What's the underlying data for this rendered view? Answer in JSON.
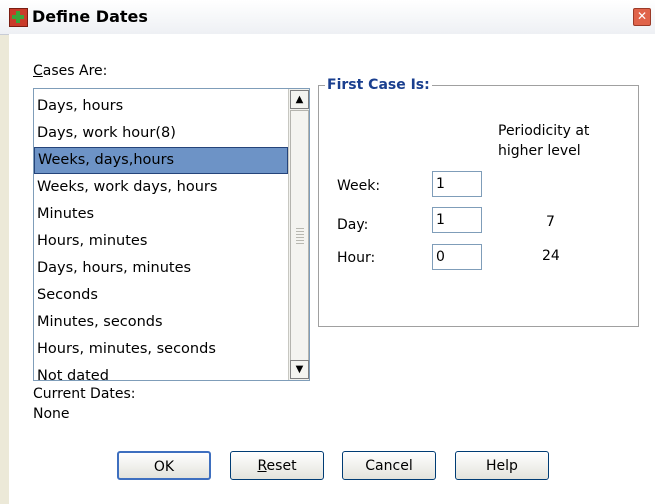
{
  "dialog": {
    "title": "Define Dates",
    "app_icon": "spss-dialog-icon",
    "close_icon": "close-icon"
  },
  "cases_are": {
    "label_access_key": "C",
    "label_rest": "ases Are:",
    "items": [
      "Days, hours",
      "Days, work hour(8)",
      "Weeks, days,hours",
      "Weeks, work days, hours",
      "Minutes",
      "Hours, minutes",
      "Days, hours, minutes",
      "Seconds",
      "Minutes, seconds",
      "Hours, minutes, seconds",
      "Not dated"
    ],
    "selected_index": 2
  },
  "first_case": {
    "legend": "First Case Is:",
    "periodicity_header": "Periodicity at higher level",
    "rows": [
      {
        "label": "Week:",
        "value": "1",
        "periodicity": ""
      },
      {
        "label": "Day:",
        "value": "1",
        "periodicity": "7"
      },
      {
        "label": "Hour:",
        "value": "0",
        "periodicity": "24"
      }
    ]
  },
  "current_dates": {
    "label": "Current Dates:",
    "value": "None"
  },
  "buttons": {
    "ok": "OK",
    "reset_access_key": "R",
    "reset_rest": "eset",
    "cancel": "Cancel",
    "help": "Help"
  },
  "colors": {
    "selection": "#6d93c6",
    "group_title": "#1a3f8f"
  }
}
